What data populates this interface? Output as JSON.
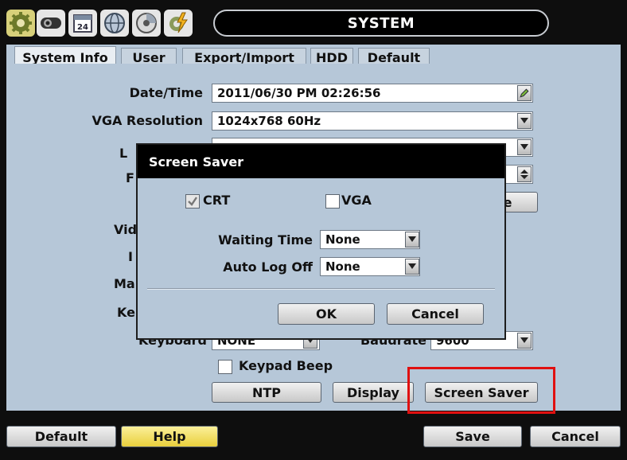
{
  "window": {
    "title": "SYSTEM"
  },
  "toolbar": {
    "icons": [
      "gear-icon",
      "camera-icon",
      "calendar-icon",
      "globe-icon",
      "disc-icon",
      "lightning-gear-icon"
    ],
    "calendar_day": "24"
  },
  "tabs": [
    {
      "label": "System Info",
      "active": true
    },
    {
      "label": "User",
      "active": false
    },
    {
      "label": "Export/Import",
      "active": false
    },
    {
      "label": "HDD",
      "active": false
    },
    {
      "label": "Default",
      "active": false
    }
  ],
  "form": {
    "datetime_label": "Date/Time",
    "datetime_value": "2011/06/30 PM 02:26:56",
    "vga_label": "VGA Resolution",
    "vga_value": "1024x768  60Hz",
    "partial_labels": [
      "L",
      "F",
      "Vid",
      "I",
      "Ma",
      "Ke"
    ],
    "partial_button": "e",
    "keyboard_label": "Keyboard",
    "keyboard_value": "NONE",
    "baudrate_label": "Baudrate",
    "baudrate_value": "9600",
    "keypad_beep_label": "Keypad Beep",
    "ntp_button": "NTP",
    "display_button": "Display",
    "screen_saver_button": "Screen Saver"
  },
  "bottom": {
    "default_button": "Default",
    "help_button": "Help",
    "save_button": "Save",
    "cancel_button": "Cancel"
  },
  "dialog": {
    "title": "Screen Saver",
    "crt_label": "CRT",
    "crt_checked": true,
    "vga_label": "VGA",
    "vga_checked": false,
    "waiting_time_label": "Waiting Time",
    "waiting_time_value": "None",
    "auto_logoff_label": "Auto Log Off",
    "auto_logoff_value": "None",
    "ok_button": "OK",
    "cancel_button": "Cancel"
  },
  "colors": {
    "panel": "#b6c7d8",
    "title_bar": "#000000",
    "highlight": "#e01010",
    "help_button": "#f0d84a"
  }
}
